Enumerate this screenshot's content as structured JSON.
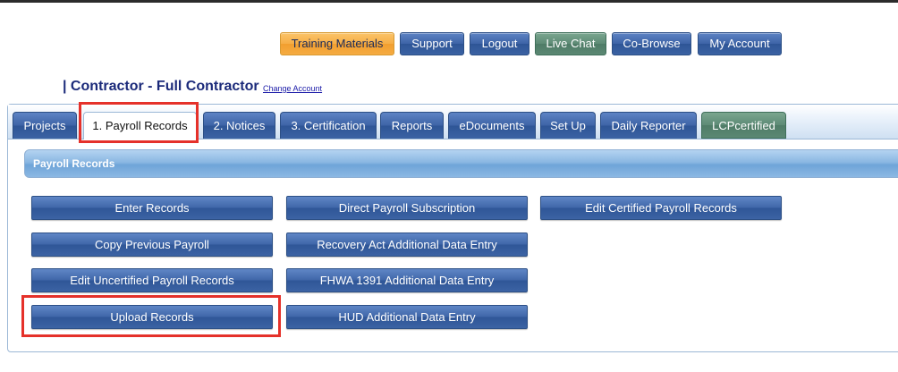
{
  "top_buttons": {
    "training": "Training Materials",
    "support": "Support",
    "logout": "Logout",
    "live_chat": "Live Chat",
    "co_browse": "Co-Browse",
    "my_account": "My Account"
  },
  "account": {
    "title": "| Contractor - Full Contractor",
    "change_link": "Change Account"
  },
  "tabs": {
    "projects": "Projects",
    "payroll_records": "1. Payroll Records",
    "notices": "2. Notices",
    "certification": "3. Certification",
    "reports": "Reports",
    "edocuments": "eDocuments",
    "set_up": "Set Up",
    "daily_reporter": "Daily Reporter",
    "lcpcertified": "LCPcertified"
  },
  "section": {
    "title": "Payroll Records"
  },
  "actions": {
    "enter_records": "Enter Records",
    "copy_previous": "Copy Previous Payroll",
    "edit_uncertified": "Edit Uncertified Payroll Records",
    "upload_records": "Upload Records",
    "direct_subscription": "Direct Payroll Subscription",
    "recovery_act": "Recovery Act Additional Data Entry",
    "fhwa_1391": "FHWA 1391 Additional Data Entry",
    "hud": "HUD Additional Data Entry",
    "edit_certified": "Edit Certified Payroll Records"
  },
  "colors": {
    "button_blue": "#3d63a6",
    "training_orange": "#f6ad45",
    "chat_green": "#5d8a75",
    "highlight_red": "#e5312a",
    "title_navy": "#1b2a7a"
  }
}
